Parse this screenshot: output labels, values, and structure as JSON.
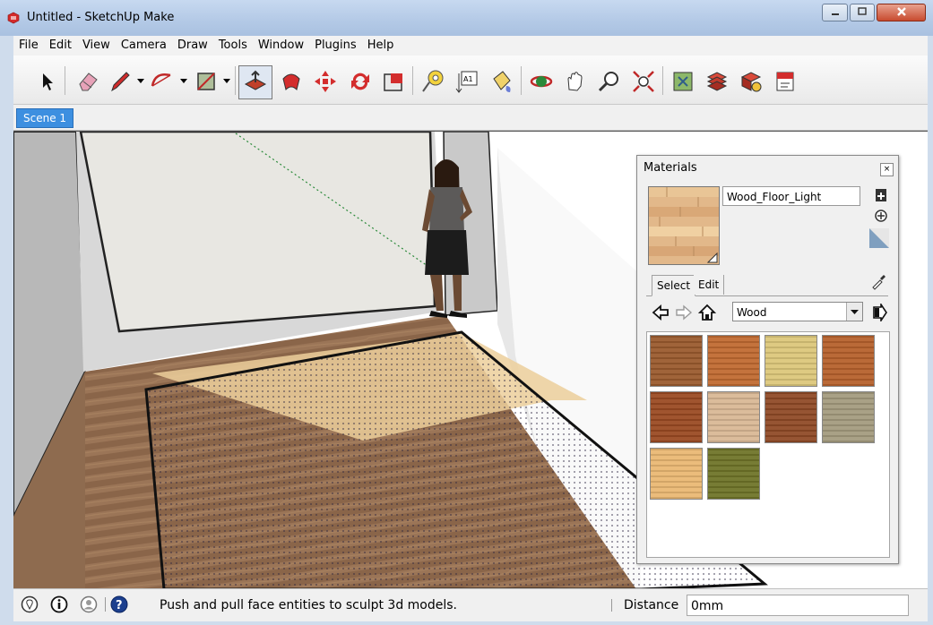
{
  "window": {
    "title": "Untitled - SketchUp Make",
    "icons": [
      "minimize-icon",
      "maximize-icon",
      "close-icon"
    ]
  },
  "menu": [
    "File",
    "Edit",
    "View",
    "Camera",
    "Draw",
    "Tools",
    "Window",
    "Plugins",
    "Help"
  ],
  "toolbar": {
    "tools": [
      "select-icon",
      "eraser-icon",
      "pencil-icon",
      "arc-icon",
      "rectangle-icon",
      "push-pull-icon",
      "follow-me-icon",
      "move-icon",
      "rotate-icon",
      "scale-icon",
      "tape-measure-icon",
      "text-icon",
      "paint-bucket-icon",
      "orbit-icon",
      "pan-icon",
      "zoom-icon",
      "zoom-extents-icon",
      "components-icon",
      "layers-icon",
      "outliner-icon",
      "styles-icon"
    ],
    "active": "push-pull-icon"
  },
  "scenes": {
    "tab": "Scene 1"
  },
  "status": {
    "message": "Push and pull face entities to sculpt 3d models.",
    "vcb_label": "Distance",
    "vcb_value": "0mm",
    "icons": [
      "geo-location-icon",
      "credits-icon",
      "user-icon",
      "help-icon"
    ]
  },
  "materials": {
    "title": "Materials",
    "current_name": "Wood_Floor_Light",
    "tabs": [
      "Select",
      "Edit"
    ],
    "active_tab": "Select",
    "library": "Wood",
    "swatches": [
      {
        "name": "wood-swatch-1",
        "color": "#9a5a2e"
      },
      {
        "name": "wood-swatch-2",
        "color": "#c06a31"
      },
      {
        "name": "wood-swatch-3",
        "color": "#dcc77a"
      },
      {
        "name": "wood-swatch-4",
        "color": "#b6612c"
      },
      {
        "name": "wood-swatch-5",
        "color": "#9a4a22"
      },
      {
        "name": "wood-swatch-6",
        "color": "#d9b895"
      },
      {
        "name": "wood-swatch-7",
        "color": "#8f4a26"
      },
      {
        "name": "wood-swatch-8",
        "color": "#a49b7e"
      },
      {
        "name": "wood-swatch-9",
        "color": "#eab873"
      },
      {
        "name": "wood-swatch-10",
        "color": "#6f7428"
      }
    ]
  },
  "colors": {
    "scene_tab": "#3d8fe0",
    "floor_light": "#f1d29c",
    "floor_dark": "#8d6a4e"
  }
}
